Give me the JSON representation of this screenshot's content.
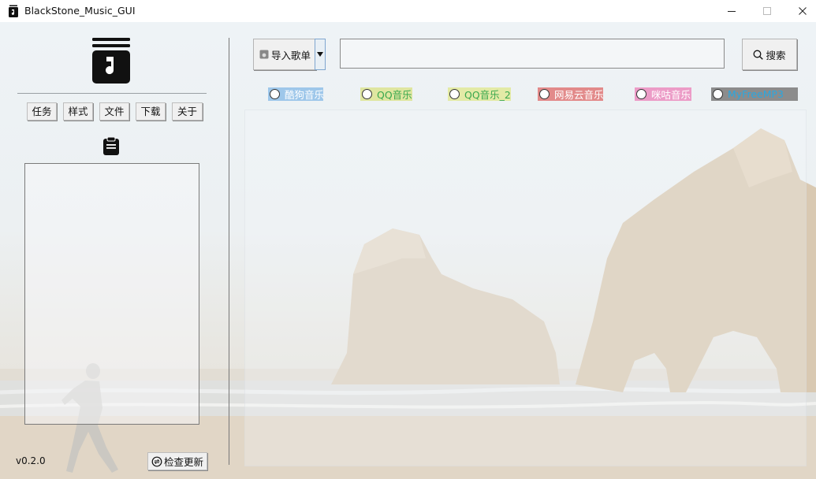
{
  "window": {
    "title": "BlackStone_Music_GUI"
  },
  "sidebar": {
    "tabs": [
      {
        "label": "任务"
      },
      {
        "label": "样式"
      },
      {
        "label": "文件"
      },
      {
        "label": "下载"
      },
      {
        "label": "关于"
      }
    ],
    "version": "v0.2.0",
    "update_label": "检查更新"
  },
  "toolbar": {
    "import_label": "导入歌单",
    "search_value": "",
    "search_label": "搜索"
  },
  "sources": [
    {
      "label": "酷狗音乐",
      "bg": "#9ec7ea",
      "color": "#ffffff",
      "selected": false
    },
    {
      "label": "QQ音乐",
      "bg": "#dfe6a0",
      "color": "#3aa84e",
      "selected": false
    },
    {
      "label": "QQ音乐_2",
      "bg": "#e3eaa6",
      "color": "#3aa84e",
      "selected": false
    },
    {
      "label": "网易云音乐",
      "bg": "#e28a8a",
      "color": "#ffffff",
      "selected": false
    },
    {
      "label": "咪咕音乐",
      "bg": "#ec9cc7",
      "color": "#ffffff",
      "selected": false
    },
    {
      "label": "MyFreeMP3",
      "bg": "#8c8c8c",
      "color": "#2aa7e0",
      "selected": false
    }
  ],
  "icons": {
    "app": "music-file-icon",
    "logo": "music-note-icon",
    "tasks": "clipboard-icon",
    "search": "search-icon",
    "update": "refresh-icon",
    "import": "playlist-icon",
    "dropdown": "triangle-down-icon"
  }
}
